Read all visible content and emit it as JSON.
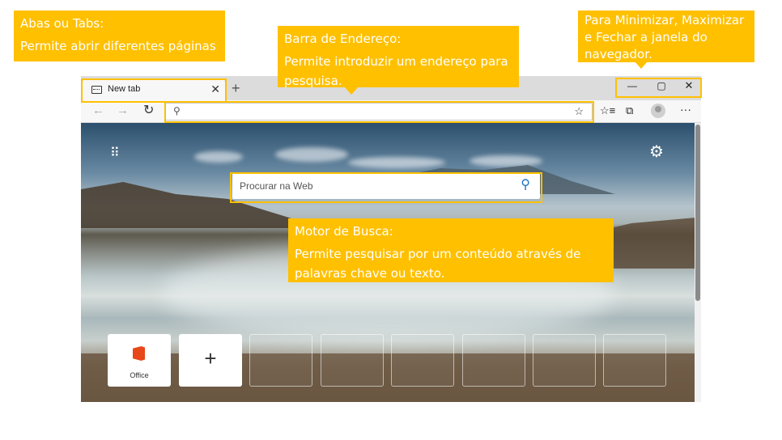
{
  "callouts": {
    "tabs": {
      "title": "Abas ou Tabs:",
      "desc": "Permite abrir diferentes páginas"
    },
    "address": {
      "title": "Barra de Endereço:",
      "desc": "Permite introduzir um endereço para pesquisa."
    },
    "window": {
      "title": "Para Minimizar, Maximizar e Fechar a janela do navegador."
    },
    "search": {
      "title": "Motor de Busca:",
      "desc": "Permite pesquisar por um conteúdo através de palavras chave ou texto."
    }
  },
  "browser": {
    "tab": {
      "label": "New tab",
      "icon": "new-tab-page-icon",
      "close": "✕"
    },
    "new_tab": "+",
    "window_controls": {
      "minimize": "—",
      "maximize": "▢",
      "close": "✕"
    },
    "toolbar": {
      "back": "←",
      "forward": "→",
      "reload": "↻",
      "address_value": "",
      "address_placeholder": "",
      "search_icon": "⚲",
      "favorite_star": "☆",
      "favorites": "☆≡",
      "collections": "⧉",
      "more": "···"
    },
    "newtab_page": {
      "apps_icon": "⠿",
      "settings_icon": "⚙",
      "web_search_placeholder": "Procurar na Web",
      "tiles": [
        {
          "label": "Office",
          "type": "office"
        },
        {
          "label": "",
          "type": "add",
          "symbol": "+"
        }
      ]
    }
  },
  "colors": {
    "accent": "#ffc000",
    "callout_text": "#ffffff",
    "search_icon": "#1a73c8",
    "office": "#e8471a"
  }
}
